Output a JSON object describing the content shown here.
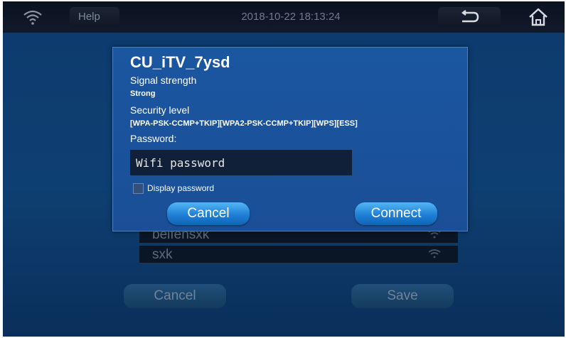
{
  "topbar": {
    "help_label": "Help",
    "datetime": "2018-10-22 18:13:24",
    "icons": {
      "wifi": "wifi-icon",
      "back": "back-arrow-icon",
      "home": "home-icon"
    }
  },
  "dialog": {
    "ssid": "CU_iTV_7ysd",
    "signal_label": "Signal strength",
    "signal_value": "Strong",
    "security_label": "Security level",
    "security_value": "[WPA-PSK-CCMP+TKIP][WPA2-PSK-CCMP+TKIP][WPS][ESS]",
    "password_label": "Password:",
    "password_value": "Wifi password",
    "display_password_label": "Display password",
    "display_password_checked": false,
    "cancel_label": "Cancel",
    "connect_label": "Connect"
  },
  "background": {
    "networks": [
      {
        "name": "beifensxk",
        "icon": "wifi-signal-icon"
      },
      {
        "name": "sxk",
        "icon": "wifi-signal-icon"
      }
    ],
    "cancel_label": "Cancel",
    "save_label": "Save"
  },
  "colors": {
    "dialog_bg": "#1b56a1",
    "button_accent": "#2b8fe6",
    "screen_bg": "#0e3f72"
  }
}
